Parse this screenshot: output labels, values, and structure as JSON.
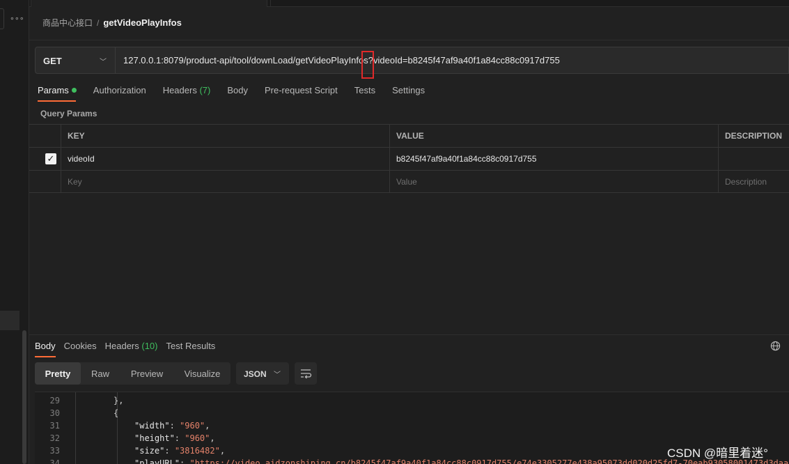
{
  "breadcrumb": {
    "collection": "商品中心接口",
    "separator": "/",
    "request": "getVideoPlayInfos"
  },
  "request": {
    "method": "GET",
    "url": "127.0.0.1:8079/product-api/tool/downLoad/getVideoPlayInfos?videoId=b8245f47af9a40f1a84cc88c0917d755"
  },
  "req_tabs": {
    "params": "Params",
    "authorization": "Authorization",
    "headers": "Headers",
    "headers_count": "(7)",
    "body": "Body",
    "prerequest": "Pre-request Script",
    "tests": "Tests",
    "settings": "Settings"
  },
  "query_params": {
    "title": "Query Params",
    "headers": {
      "key": "KEY",
      "value": "VALUE",
      "description": "DESCRIPTION"
    },
    "rows": [
      {
        "checked": true,
        "key": "videoId",
        "value": "b8245f47af9a40f1a84cc88c0917d755",
        "description": ""
      }
    ],
    "placeholder": {
      "key": "Key",
      "value": "Value",
      "description": "Description"
    }
  },
  "resp_tabs": {
    "body": "Body",
    "cookies": "Cookies",
    "headers": "Headers",
    "headers_count": "(10)",
    "test_results": "Test Results"
  },
  "view_modes": {
    "pretty": "Pretty",
    "raw": "Raw",
    "preview": "Preview",
    "visualize": "Visualize"
  },
  "format": "JSON",
  "code_lines": [
    {
      "n": "29",
      "indent": 0,
      "text": "},"
    },
    {
      "n": "30",
      "indent": 0,
      "text": "{"
    },
    {
      "n": "31",
      "indent": 1,
      "key": "\"width\"",
      "val": "\"960\"",
      "end": ","
    },
    {
      "n": "32",
      "indent": 1,
      "key": "\"height\"",
      "val": "\"960\"",
      "end": ","
    },
    {
      "n": "33",
      "indent": 1,
      "key": "\"size\"",
      "val": "\"3816482\"",
      "end": ","
    },
    {
      "n": "34",
      "indent": 1,
      "key": "\"playURL\"",
      "val": "\"https://video.aidzonshiping.cn/b8245f47af9a40f1a84cc88c0917d755/e74e3305277e438a95073dd020d25fd7-70eab93058001473d3daa",
      "end": ""
    }
  ],
  "watermark": "CSDN @暗里着迷°",
  "colors": {
    "accent": "#ff6c37",
    "green": "#3fbf5f",
    "highlight_box": "#e02a2a",
    "string": "#e5826a"
  }
}
